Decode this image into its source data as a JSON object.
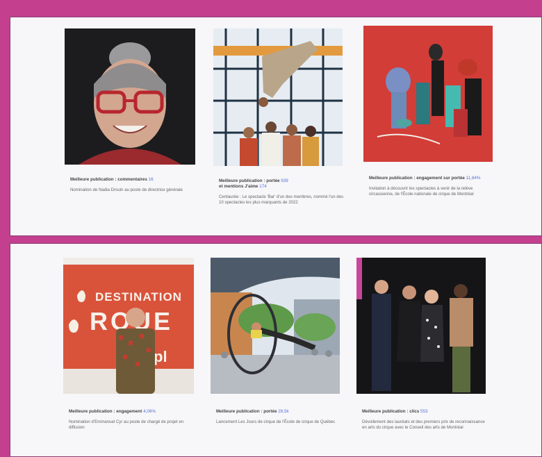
{
  "panel_top": {
    "cards": [
      {
        "image_alt": "Nadia Drouin portrait",
        "label": "Meilleure publication : commentaires",
        "stat": "16",
        "description": "Nomination de Nadia Drouin au poste de directrice générale"
      },
      {
        "image_alt": "Circus performers on a grid",
        "label": "Meilleure publication : portée",
        "stat": "939",
        "label_2": "et mentions J'aime",
        "stat_2": "174",
        "description": "Centaurée : Le spectacle 'Bar' d'un des membres, nommé l'un des 10 spectacles les plus marquants de 2022"
      },
      {
        "image_alt": "Circus students group on red background",
        "label": "Meilleure publication : engagement sur portée",
        "stat": "11,84%",
        "description": "Invitation à découvrir les spectacles à venir de la relève circassienne, de l'École nationale de cirque de Montréal"
      }
    ]
  },
  "panel_bottom": {
    "cards": [
      {
        "image_alt": "Destination Cirque banner portrait",
        "banner_text_1": "DESTINATION",
        "banner_text_2": "RQUE",
        "banner_text_3": "pl",
        "label": "Meilleure publication : engagement",
        "stat": "4,06%",
        "description": "Nomination d'Emmanuel Cyr au poste de chargé de projet en diffusion"
      },
      {
        "image_alt": "Cyr wheel performer outdoors",
        "label": "Meilleure publication : portée",
        "stat": "28,5k",
        "description": "Lancement Les Jours de cirque de l'École de cirque de Québec"
      },
      {
        "image_alt": "Award recipients group photo",
        "label": "Meilleure publication : clics",
        "stat": "553",
        "description": "Dévoilement des lauréats et des premiers prix de reconnaissance en arts du cirque avec le Conseil des arts de Montréal"
      }
    ]
  },
  "colors": {
    "background": "#c4408f",
    "panel": "#f7f6f8",
    "stat_accent": "#5570d8",
    "banner_orange": "#d9533a"
  }
}
